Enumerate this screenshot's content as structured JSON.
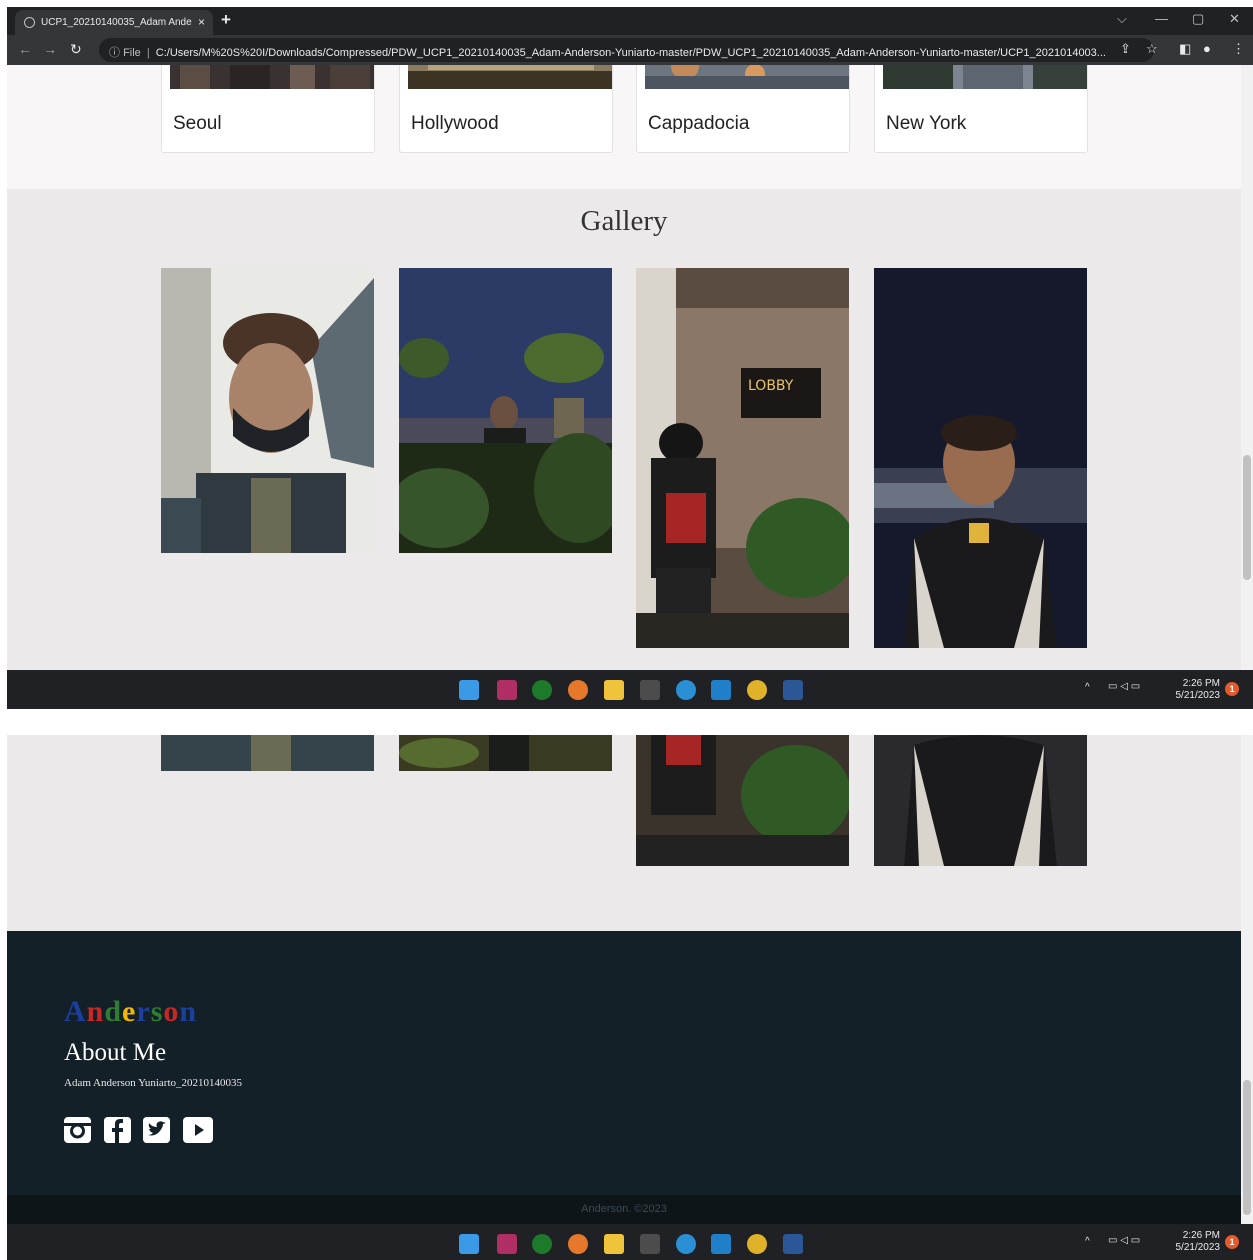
{
  "browser": {
    "tab_title": "UCP1_20210140035_Adam Ande",
    "new_tab": "+",
    "close_tab": "×",
    "omnibox_prefix": "File",
    "omnibox_separator": "|",
    "url": "C:/Users/M%20S%20I/Downloads/Compressed/PDW_UCP1_20210140035_Adam-Anderson-Yuniarto-master/PDW_UCP1_20210140035_Adam-Anderson-Yuniarto-master/UCP1_2021014003..."
  },
  "destinations": {
    "cards": [
      {
        "label": "Seoul"
      },
      {
        "label": "Hollywood"
      },
      {
        "label": "Cappadocia"
      },
      {
        "label": "New York"
      }
    ]
  },
  "gallery": {
    "title": "Gallery"
  },
  "taskbar": {
    "time": "2:26 PM",
    "date": "5/21/2023",
    "notification_count": "1"
  },
  "footer": {
    "logo": "Anderson",
    "about_title": "About Me",
    "about_name": "Adam Anderson Yuniarto_20210140035",
    "social": [
      "instagram-icon",
      "facebook-icon",
      "twitter-icon",
      "youtube-icon"
    ],
    "copyright": "Anderson. ©2023"
  },
  "colors": {
    "footer_bg": "#142027",
    "gallery_bg": "#ece9ea",
    "logo_letters": [
      "#1c3f9e",
      "#c62828",
      "#2e7d32",
      "#f2b705",
      "#1c3f9e",
      "#2e7d32",
      "#c62828",
      "#1c3f9e"
    ]
  }
}
